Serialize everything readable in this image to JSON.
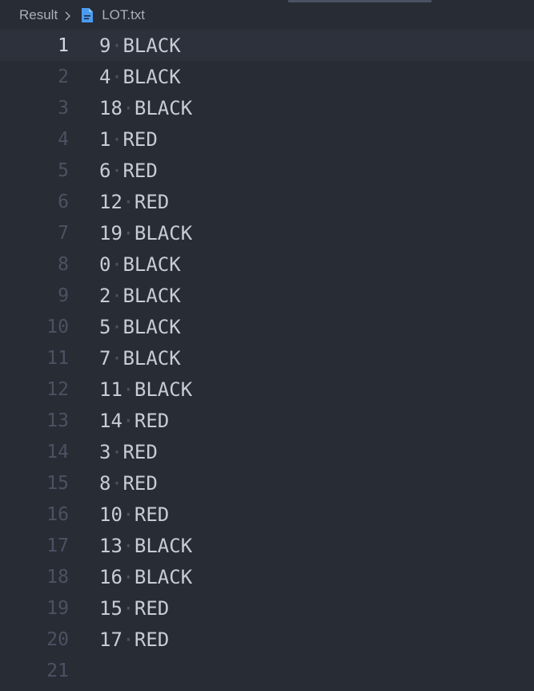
{
  "breadcrumb": {
    "root": "Result",
    "separator_icon": "chevron-right-icon",
    "file_icon": "file-text-icon",
    "file_name": "LOT.txt"
  },
  "colors": {
    "background": "#282c34",
    "active_line": "#2c313c",
    "line_number": "#4b5263",
    "active_line_number": "#d7dae0",
    "text": "#c8ccd4",
    "file_icon": "#4a9bf0"
  },
  "editor": {
    "active_line": 1,
    "lines": [
      {
        "number": "1",
        "num": "9",
        "word": "BLACK"
      },
      {
        "number": "2",
        "num": "4",
        "word": "BLACK"
      },
      {
        "number": "3",
        "num": "18",
        "word": "BLACK"
      },
      {
        "number": "4",
        "num": "1",
        "word": "RED"
      },
      {
        "number": "5",
        "num": "6",
        "word": "RED"
      },
      {
        "number": "6",
        "num": "12",
        "word": "RED"
      },
      {
        "number": "7",
        "num": "19",
        "word": "BLACK"
      },
      {
        "number": "8",
        "num": "0",
        "word": "BLACK"
      },
      {
        "number": "9",
        "num": "2",
        "word": "BLACK"
      },
      {
        "number": "10",
        "num": "5",
        "word": "BLACK"
      },
      {
        "number": "11",
        "num": "7",
        "word": "BLACK"
      },
      {
        "number": "12",
        "num": "11",
        "word": "BLACK"
      },
      {
        "number": "13",
        "num": "14",
        "word": "RED"
      },
      {
        "number": "14",
        "num": "3",
        "word": "RED"
      },
      {
        "number": "15",
        "num": "8",
        "word": "RED"
      },
      {
        "number": "16",
        "num": "10",
        "word": "RED"
      },
      {
        "number": "17",
        "num": "13",
        "word": "BLACK"
      },
      {
        "number": "18",
        "num": "16",
        "word": "BLACK"
      },
      {
        "number": "19",
        "num": "15",
        "word": "RED"
      },
      {
        "number": "20",
        "num": "17",
        "word": "RED"
      },
      {
        "number": "21",
        "num": "",
        "word": ""
      }
    ]
  }
}
